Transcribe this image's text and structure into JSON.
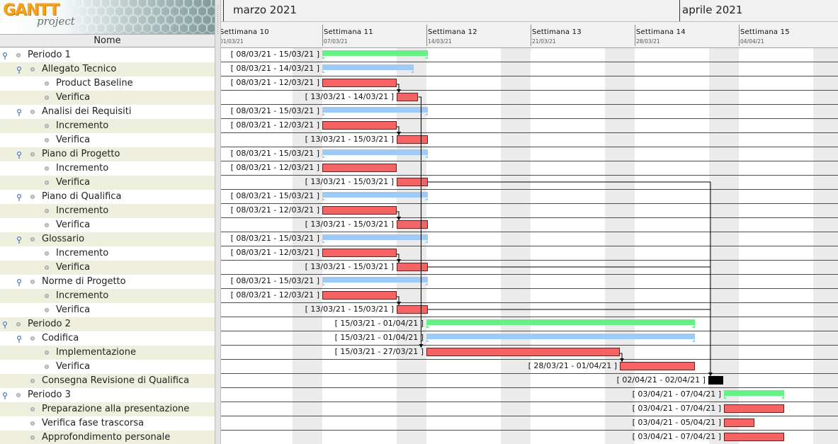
{
  "app": {
    "logo_text": "GANTT",
    "logo_sub": "project"
  },
  "tree_header": "Nome",
  "timeline": {
    "months": [
      {
        "label": "marzo 2021"
      },
      {
        "label": "aprile 2021"
      }
    ],
    "weeks": [
      {
        "label": "Settimana 10",
        "date": "01/03/21"
      },
      {
        "label": "Settimana 11",
        "date": "07/03/21"
      },
      {
        "label": "Settimana 12",
        "date": "14/03/21"
      },
      {
        "label": "Settimana 13",
        "date": "21/03/21"
      },
      {
        "label": "Settimana 14",
        "date": "28/03/21"
      },
      {
        "label": "Settimana 15",
        "date": "04/04/21"
      }
    ]
  },
  "colors": {
    "task": "#f56464",
    "summary_green": "#66f085",
    "summary_blue": "#9fcaf5",
    "milestone": "#000000"
  },
  "tasks": [
    {
      "name": "Periodo 1",
      "level": 0,
      "expandable": true,
      "type": "summary-green",
      "label": "[ 08/03/21 - 15/03/21 ]"
    },
    {
      "name": "Allegato Tecnico",
      "level": 1,
      "expandable": true,
      "type": "summary-blue",
      "label": "[ 08/03/21 - 14/03/21 ]"
    },
    {
      "name": "Product Baseline",
      "level": 2,
      "expandable": false,
      "type": "task",
      "label": "[ 08/03/21 - 12/03/21 ]"
    },
    {
      "name": "Verifica",
      "level": 2,
      "expandable": false,
      "type": "task",
      "label": "[ 13/03/21 - 14/03/21 ]"
    },
    {
      "name": "Analisi dei Requisiti",
      "level": 1,
      "expandable": true,
      "type": "summary-blue",
      "label": "[ 08/03/21 - 15/03/21 ]"
    },
    {
      "name": "Incremento",
      "level": 2,
      "expandable": false,
      "type": "task",
      "label": "[ 08/03/21 - 12/03/21 ]"
    },
    {
      "name": "Verifica",
      "level": 2,
      "expandable": false,
      "type": "task",
      "label": "[ 13/03/21 - 15/03/21 ]"
    },
    {
      "name": "Piano di Progetto",
      "level": 1,
      "expandable": true,
      "type": "summary-blue",
      "label": "[ 08/03/21 - 15/03/21 ]"
    },
    {
      "name": "Incremento",
      "level": 2,
      "expandable": false,
      "type": "task",
      "label": "[ 08/03/21 - 12/03/21 ]"
    },
    {
      "name": "Verifica",
      "level": 2,
      "expandable": false,
      "type": "task",
      "label": "[ 13/03/21 - 15/03/21 ]"
    },
    {
      "name": "Piano di Qualifica",
      "level": 1,
      "expandable": true,
      "type": "summary-blue",
      "label": "[ 08/03/21 - 15/03/21 ]"
    },
    {
      "name": "Incremento",
      "level": 2,
      "expandable": false,
      "type": "task",
      "label": "[ 08/03/21 - 12/03/21 ]"
    },
    {
      "name": "Verifica",
      "level": 2,
      "expandable": false,
      "type": "task",
      "label": "[ 13/03/21 - 15/03/21 ]"
    },
    {
      "name": "Glossario",
      "level": 1,
      "expandable": true,
      "type": "summary-blue",
      "label": "[ 08/03/21 - 15/03/21 ]"
    },
    {
      "name": "Incremento",
      "level": 2,
      "expandable": false,
      "type": "task",
      "label": "[ 08/03/21 - 12/03/21 ]"
    },
    {
      "name": "Verifica",
      "level": 2,
      "expandable": false,
      "type": "task",
      "label": "[ 13/03/21 - 15/03/21 ]"
    },
    {
      "name": "Norme di Progetto",
      "level": 1,
      "expandable": true,
      "type": "summary-blue",
      "label": "[ 08/03/21 - 15/03/21 ]"
    },
    {
      "name": "Incremento",
      "level": 2,
      "expandable": false,
      "type": "task",
      "label": "[ 08/03/21 - 12/03/21 ]"
    },
    {
      "name": "Verifica",
      "level": 2,
      "expandable": false,
      "type": "task",
      "label": "[ 13/03/21 - 15/03/21 ]"
    },
    {
      "name": "Periodo 2",
      "level": 0,
      "expandable": true,
      "type": "summary-green",
      "label": "[ 15/03/21 - 01/04/21 ]"
    },
    {
      "name": "Codifica",
      "level": 1,
      "expandable": true,
      "type": "summary-blue",
      "label": "[ 15/03/21 - 01/04/21 ]"
    },
    {
      "name": "Implementazione",
      "level": 2,
      "expandable": false,
      "type": "task",
      "label": "[ 15/03/21 - 27/03/21 ]"
    },
    {
      "name": "Verifica",
      "level": 2,
      "expandable": false,
      "type": "task",
      "label": "[ 28/03/21 - 01/04/21 ]"
    },
    {
      "name": "Consegna Revisione di Qualifica",
      "level": 1,
      "expandable": false,
      "type": "milestone",
      "label": "[ 02/04/21 - 02/04/21 ]"
    },
    {
      "name": "Periodo 3",
      "level": 0,
      "expandable": true,
      "type": "summary-green",
      "label": "[ 03/04/21 - 07/04/21 ]"
    },
    {
      "name": "Preparazione alla presentazione",
      "level": 1,
      "expandable": false,
      "type": "task",
      "label": "[ 03/04/21 - 07/04/21 ]"
    },
    {
      "name": "Verifica fase trascorsa",
      "level": 1,
      "expandable": false,
      "type": "task",
      "label": "[ 03/04/21 - 05/04/21 ]"
    },
    {
      "name": "Approfondimento personale",
      "level": 1,
      "expandable": false,
      "type": "task",
      "label": "[ 03/04/21 - 07/04/21 ]"
    }
  ]
}
